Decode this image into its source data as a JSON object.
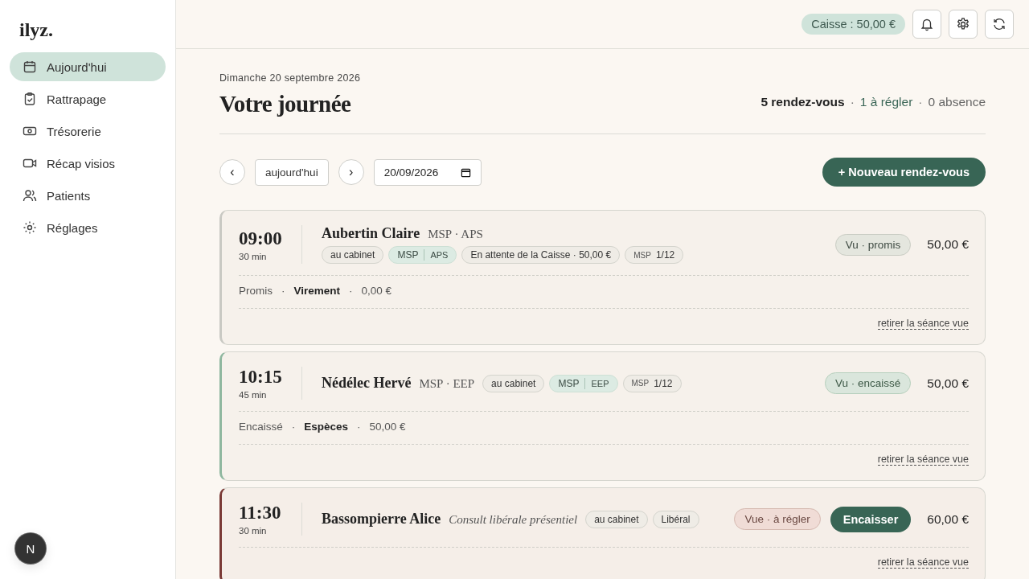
{
  "brand": "ilyz.",
  "sidebar": {
    "items": [
      {
        "label": "Aujourd'hui",
        "kind": "calendar",
        "selected": true
      },
      {
        "label": "Rattrapage",
        "kind": "clipboard",
        "selected": false
      },
      {
        "label": "Trésorerie",
        "kind": "cash",
        "selected": false
      },
      {
        "label": "Récap visios",
        "kind": "video",
        "selected": false
      },
      {
        "label": "Patients",
        "kind": "users",
        "selected": false
      },
      {
        "label": "Réglages",
        "kind": "sun",
        "selected": false
      }
    ],
    "avatar": "N"
  },
  "topbar": {
    "cash": "Caisse : 50,00 €"
  },
  "page": {
    "date": "Dimanche 20 septembre 2026",
    "title": "Votre journée",
    "summary": [
      {
        "text": "5 rendez-vous",
        "kind": "total"
      },
      {
        "text": "·",
        "kind": "sep"
      },
      {
        "text": "1 à régler",
        "kind": "due"
      },
      {
        "text": "·",
        "kind": "sep"
      },
      {
        "text": "0 absence",
        "kind": "muted"
      }
    ]
  },
  "toolbar": {
    "prev": "‹",
    "today": "aujourd'hui",
    "next": "›",
    "date_value": "20/09/2026",
    "new_button": "+ Nouveau rendez-vous"
  },
  "appointments": [
    {
      "time": "09:00",
      "duration": "30 min",
      "name": "Aubertin Claire",
      "act": "MSP · APS",
      "act_italic": false,
      "tags_inline": false,
      "tags": [
        {
          "kind": "plain",
          "label": "au cabinet"
        },
        {
          "kind": "pair",
          "left": "MSP",
          "right": "APS"
        },
        {
          "kind": "plain",
          "label": "En attente de la Caisse · 50,00 €"
        },
        {
          "kind": "count",
          "prefix": "MSP",
          "value": "1/12"
        }
      ],
      "status": {
        "label": "Vu · promis",
        "kind": "promised"
      },
      "amount": "50,00 €",
      "payment": [
        {
          "text": "Promis",
          "kind": "status"
        },
        {
          "text": "·",
          "kind": "sep"
        },
        {
          "text": "Virement",
          "kind": "method"
        },
        {
          "text": "·",
          "kind": "sep"
        },
        {
          "text": "0,00 €",
          "kind": "amount"
        }
      ],
      "remove_link": "retirer la séance vue"
    },
    {
      "time": "10:15",
      "duration": "45 min",
      "name": "Nédélec Hervé",
      "act": "MSP · EEP",
      "act_italic": false,
      "tags_inline": true,
      "tags": [
        {
          "kind": "plain",
          "label": "au cabinet"
        },
        {
          "kind": "pair",
          "left": "MSP",
          "right": "EEP"
        },
        {
          "kind": "count",
          "prefix": "MSP",
          "value": "1/12"
        }
      ],
      "status": {
        "label": "Vu · encaissé",
        "kind": "paid"
      },
      "amount": "50,00 €",
      "payment": [
        {
          "text": "Encaissé",
          "kind": "status"
        },
        {
          "text": "·",
          "kind": "sep"
        },
        {
          "text": "Espèces",
          "kind": "method"
        },
        {
          "text": "·",
          "kind": "sep"
        },
        {
          "text": "50,00 €",
          "kind": "amount"
        }
      ],
      "remove_link": "retirer la séance vue"
    },
    {
      "time": "11:30",
      "duration": "30 min",
      "name": "Bassompierre Alice",
      "act": "Consult libérale présentiel",
      "act_italic": true,
      "tags_inline": true,
      "tags": [
        {
          "kind": "plain",
          "label": "au cabinet"
        },
        {
          "kind": "plain",
          "label": "Libéral"
        }
      ],
      "status": {
        "label": "Vue · à régler",
        "kind": "due"
      },
      "action": "Encaisser",
      "amount": "60,00 €",
      "remove_link": "retirer la séance vue"
    }
  ]
}
